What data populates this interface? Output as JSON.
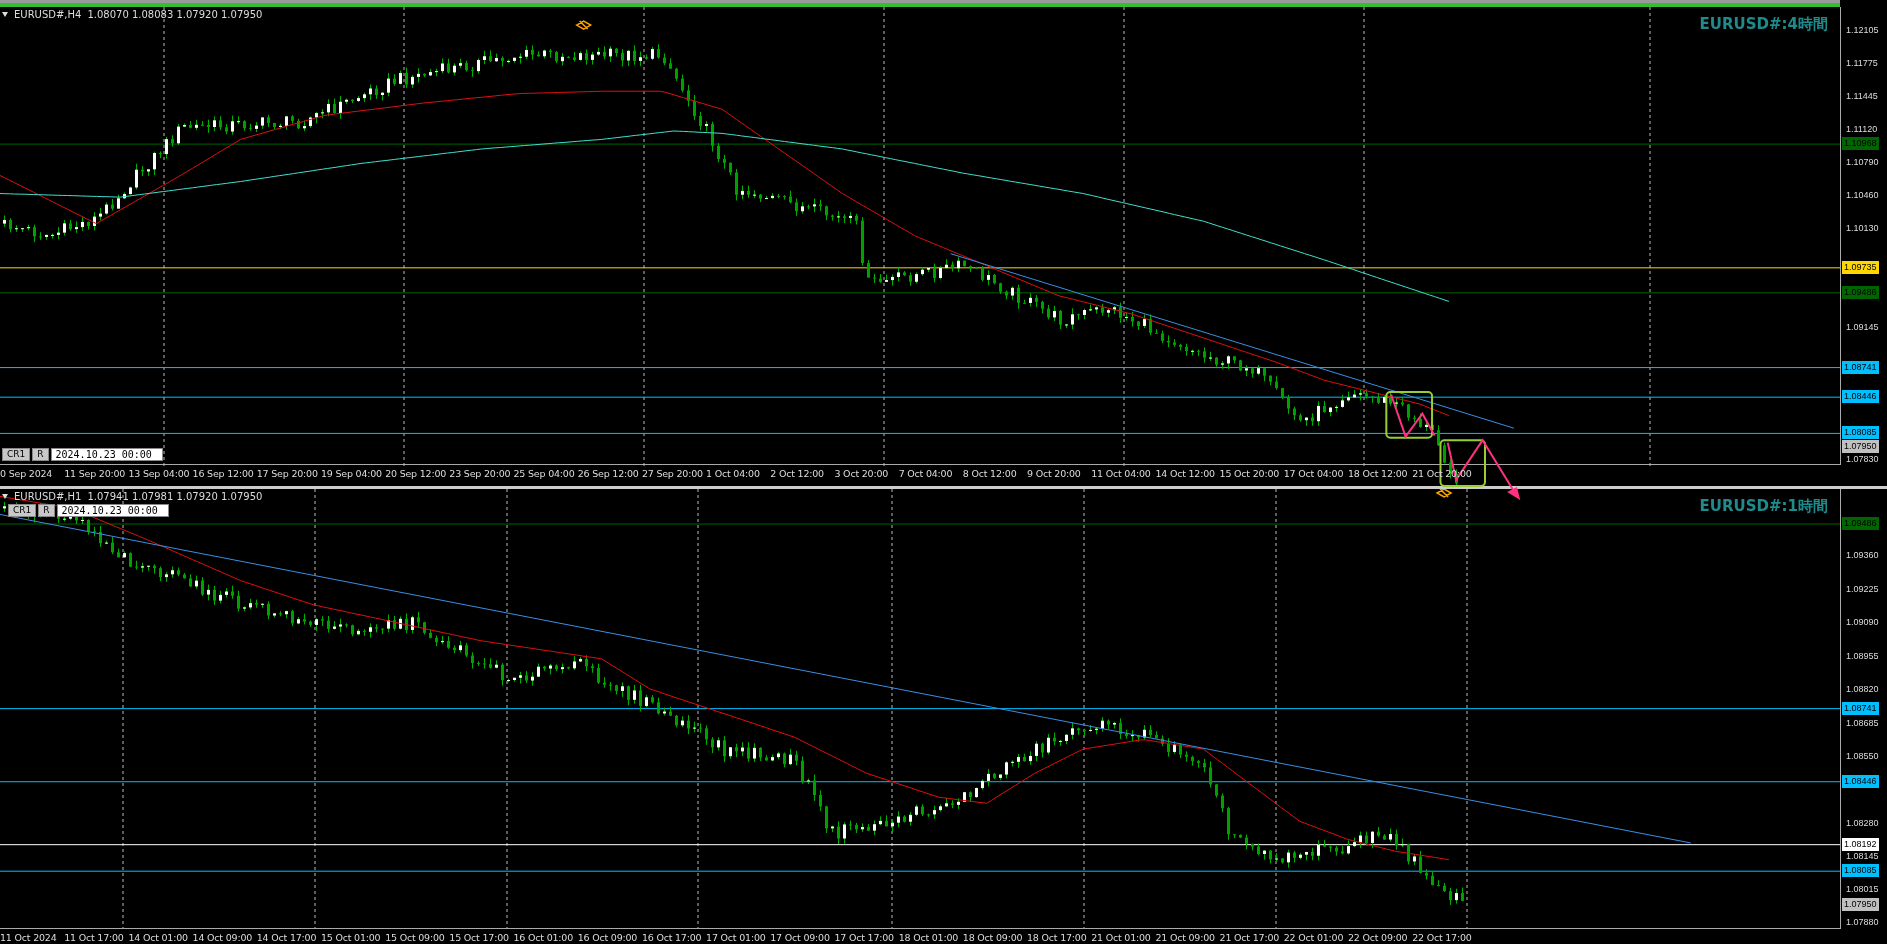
{
  "panes": [
    {
      "header": {
        "symbol": "EURUSD#,H4",
        "quotes": "1.08070 1.08083 1.07920 1.07950"
      },
      "title": "EURUSD#:4時間",
      "toolbar": {
        "buttons": [
          "CR1",
          "R"
        ],
        "date": "2024.10.23 00:00"
      },
      "price_ticks": [
        "1.12105",
        "1.11775",
        "1.11445",
        "1.11120",
        "1.10790",
        "1.10460",
        "1.10130",
        "1.09145",
        "1.07830"
      ],
      "price_lines": [
        {
          "price": "1.10968",
          "color": "#006400"
        },
        {
          "price": "1.09735",
          "color": "#ffd700"
        },
        {
          "price": "1.09486",
          "color": "#006400"
        },
        {
          "price": "1.08741",
          "color": "#00bfff"
        },
        {
          "price": "1.08446",
          "color": "#00bfff"
        },
        {
          "price": "1.08085",
          "color": "#00bfff"
        }
      ],
      "current_price": "1.07950",
      "time_labels": [
        "0 Sep 2024",
        "11 Sep 20:00",
        "13 Sep 04:00",
        "16 Sep 12:00",
        "17 Sep 20:00",
        "19 Sep 04:00",
        "20 Sep 12:00",
        "23 Sep 20:00",
        "25 Sep 04:00",
        "26 Sep 12:00",
        "27 Sep 20:00",
        "1 Oct 04:00",
        "2 Oct 12:00",
        "3 Oct 20:00",
        "7 Oct 04:00",
        "8 Oct 12:00",
        "9 Oct 20:00",
        "11 Oct 04:00",
        "14 Oct 12:00",
        "15 Oct 20:00",
        "17 Oct 04:00",
        "18 Oct 12:00",
        "21 Oct 20:00"
      ]
    },
    {
      "header": {
        "symbol": "EURUSD#,H1",
        "quotes": "1.07941 1.07981 1.07920 1.07950"
      },
      "title": "EURUSD#:1時間",
      "toolbar": {
        "buttons": [
          "CR1",
          "R"
        ],
        "date": "2024.10.23 00:00"
      },
      "price_ticks": [
        "1.09360",
        "1.09225",
        "1.09090",
        "1.08955",
        "1.08820",
        "1.08685",
        "1.08550",
        "1.08280",
        "1.08145",
        "1.08015",
        "1.07880"
      ],
      "price_lines": [
        {
          "price": "1.09486",
          "color": "#006400"
        },
        {
          "price": "1.08741",
          "color": "#00bfff"
        },
        {
          "price": "1.08446",
          "color": "#00bfff"
        },
        {
          "price": "1.08192",
          "color": "#ffffff"
        },
        {
          "price": "1.08085",
          "color": "#00bfff"
        }
      ],
      "current_price": "1.07950",
      "time_labels": [
        "11 Oct 2024",
        "11 Oct 17:00",
        "14 Oct 01:00",
        "14 Oct 09:00",
        "14 Oct 17:00",
        "15 Oct 01:00",
        "15 Oct 09:00",
        "15 Oct 17:00",
        "16 Oct 01:00",
        "16 Oct 09:00",
        "16 Oct 17:00",
        "17 Oct 01:00",
        "17 Oct 09:00",
        "17 Oct 17:00",
        "18 Oct 01:00",
        "18 Oct 09:00",
        "18 Oct 17:00",
        "21 Oct 01:00",
        "21 Oct 09:00",
        "21 Oct 17:00",
        "22 Oct 01:00",
        "22 Oct 09:00",
        "22 Oct 17:00"
      ]
    }
  ]
}
